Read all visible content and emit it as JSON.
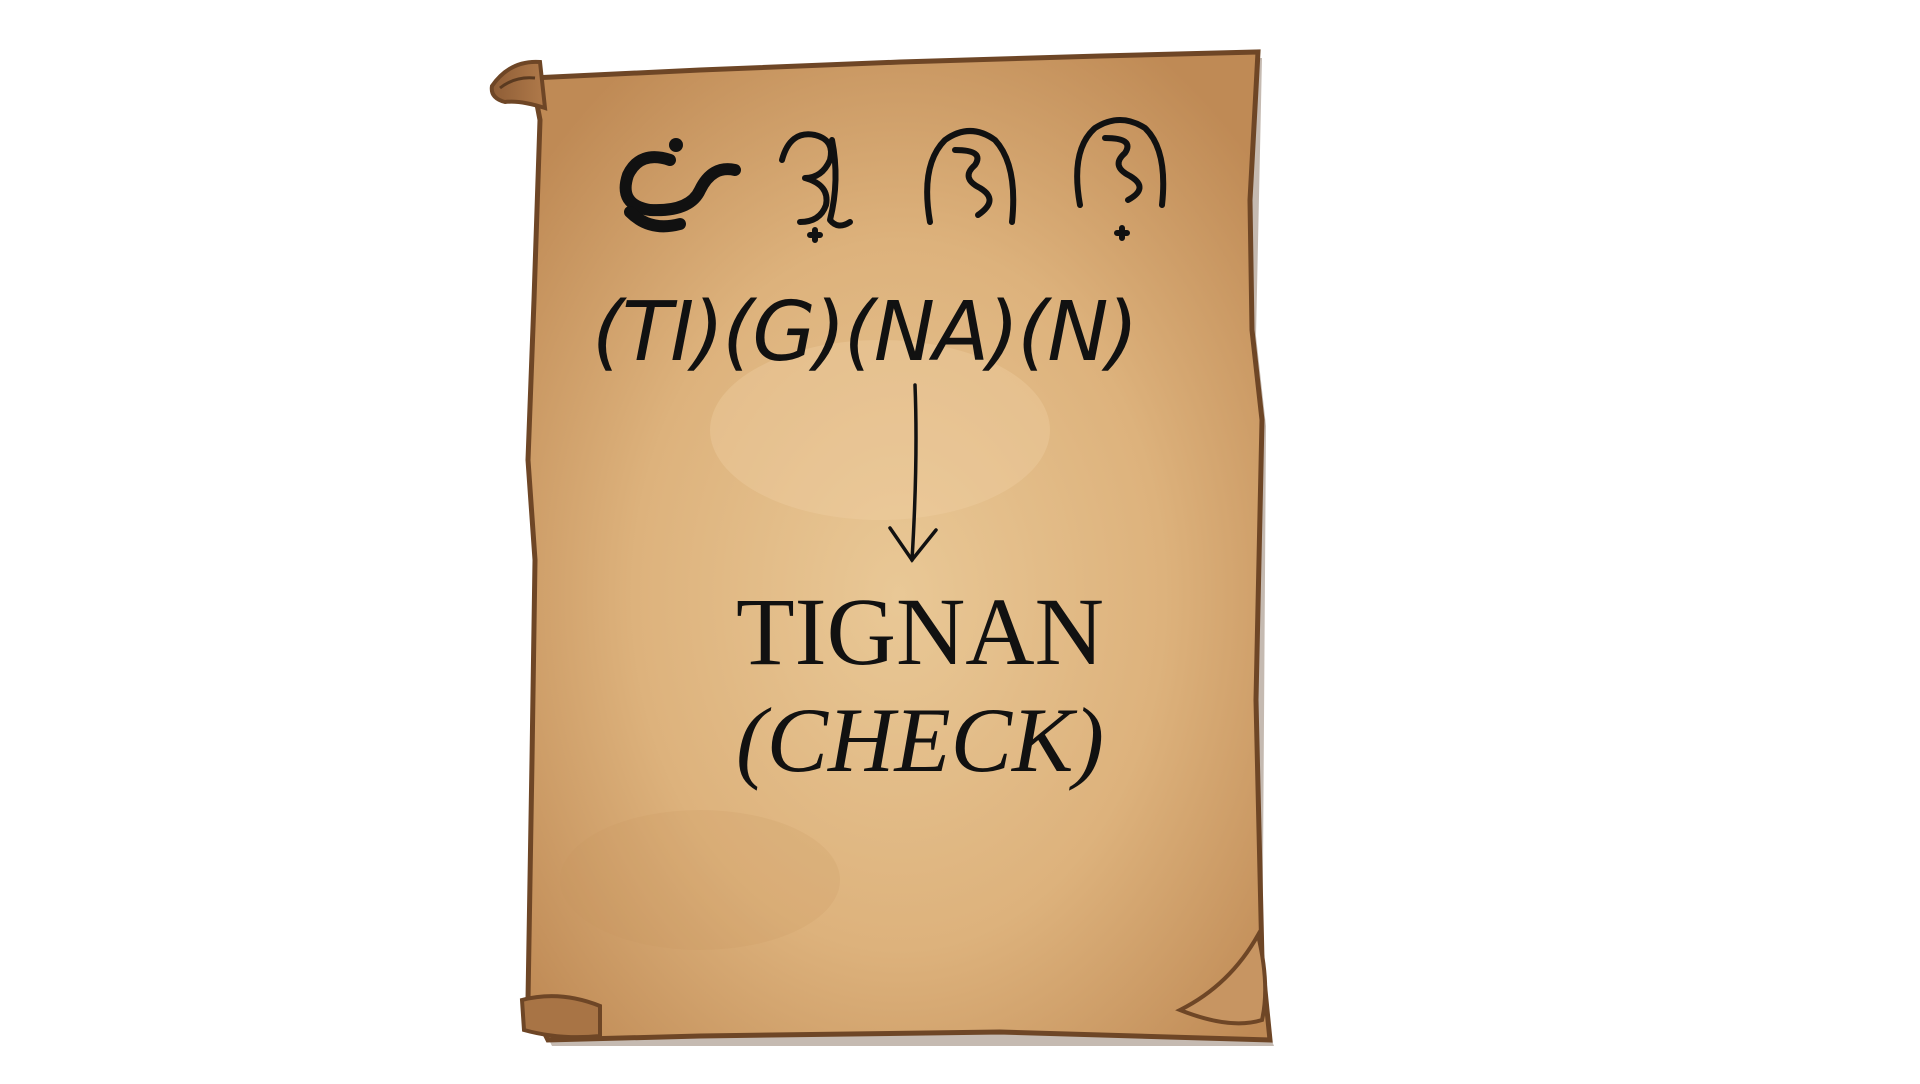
{
  "scroll": {
    "baybayin_glyphs": [
      "ti",
      "g",
      "na",
      "n"
    ],
    "syllables": [
      "(TI)",
      "(G)",
      "(NA)",
      "(N)"
    ],
    "word": "TIGNAN",
    "translation": "(CHECK)",
    "colors": {
      "parchment_light": "#e8c594",
      "parchment_mid": "#d3a773",
      "parchment_edge": "#a87445",
      "ink": "#111111"
    }
  }
}
